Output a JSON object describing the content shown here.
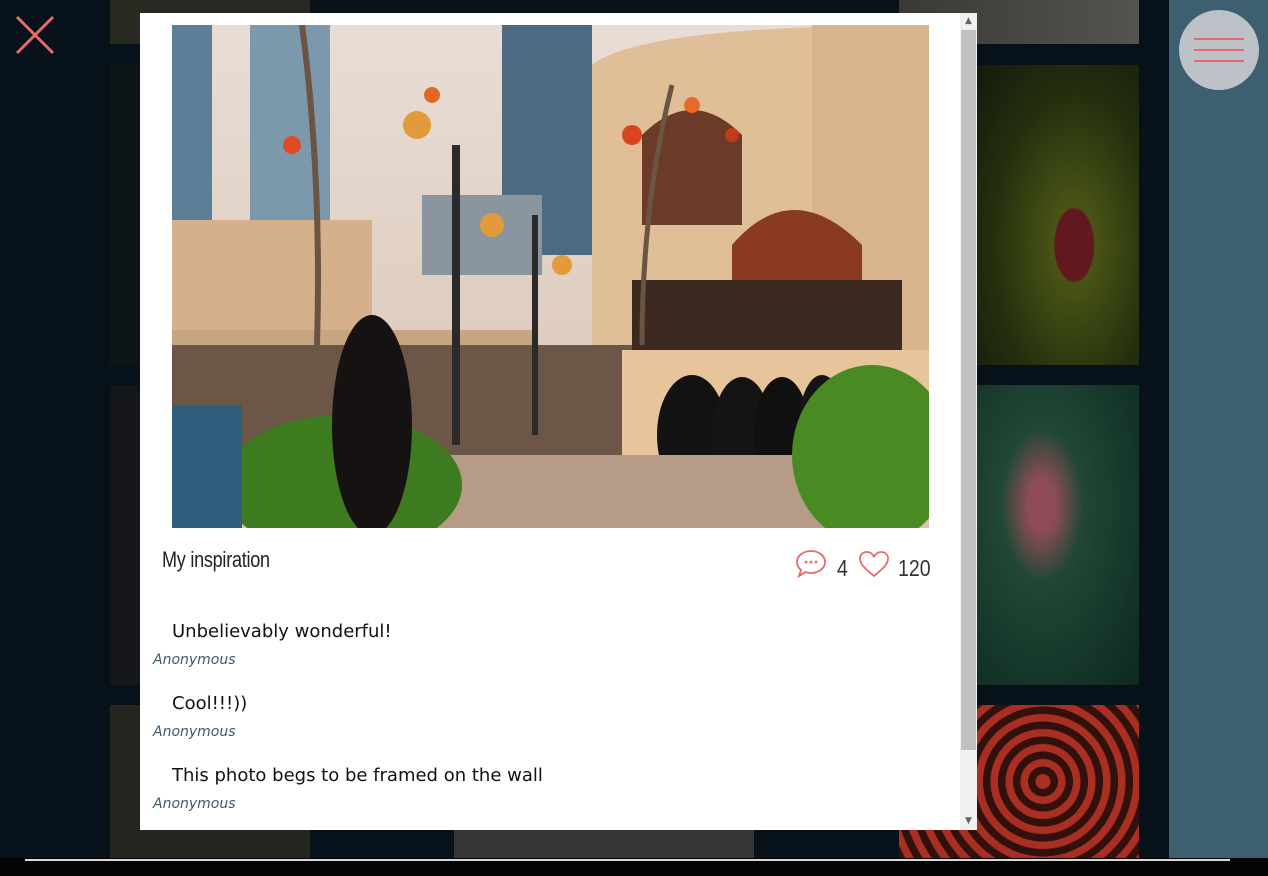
{
  "modal": {
    "title": "My inspiration",
    "comments_count": "4",
    "likes_count": "120",
    "comments": [
      {
        "text": "Unbelievably wonderful!",
        "author": "Anonymous"
      },
      {
        "text": "Cool!!!))",
        "author": "Anonymous"
      },
      {
        "text": "This photo begs to be framed on the wall",
        "author": "Anonymous"
      }
    ]
  },
  "icons": {
    "close": "close-icon",
    "menu": "hamburger-menu-icon",
    "comments": "speech-bubble-icon",
    "likes": "heart-icon"
  },
  "colors": {
    "accent": "#e86a6a",
    "author": "#3b5a6b",
    "side_panel": "#3e5f70"
  }
}
